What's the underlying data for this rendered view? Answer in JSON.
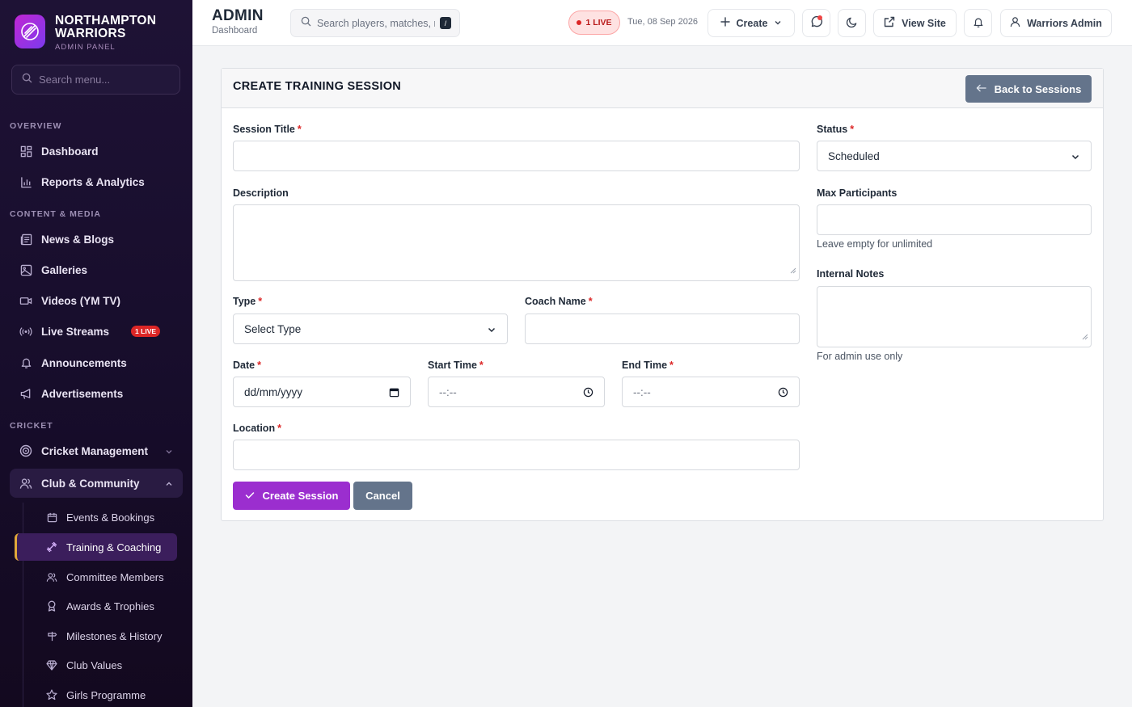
{
  "brand": {
    "name_line1": "NORTHAMPTON",
    "name_line2": "WARRIORS",
    "subtitle": "ADMIN PANEL"
  },
  "sidebar": {
    "search_placeholder": "Search menu...",
    "sections": [
      "OVERVIEW",
      "CONTENT & MEDIA",
      "CRICKET"
    ],
    "items": [
      {
        "label": "Dashboard",
        "icon": "grid-icon"
      },
      {
        "label": "Reports & Analytics",
        "icon": "bar-chart-icon"
      },
      {
        "label": "News & Blogs",
        "icon": "newspaper-icon"
      },
      {
        "label": "Galleries",
        "icon": "image-icon"
      },
      {
        "label": "Videos (YM TV)",
        "icon": "video-icon"
      },
      {
        "label": "Live Streams",
        "icon": "broadcast-icon",
        "badge": "1 LIVE"
      },
      {
        "label": "Announcements",
        "icon": "bell-icon"
      },
      {
        "label": "Advertisements",
        "icon": "megaphone-icon"
      },
      {
        "label": "Cricket Management",
        "icon": "target-icon"
      },
      {
        "label": "Club & Community",
        "icon": "users-icon"
      }
    ],
    "sub_items": [
      {
        "label": "Events & Bookings",
        "icon": "calendar-icon"
      },
      {
        "label": "Training & Coaching",
        "icon": "dumbbell-icon",
        "active": true
      },
      {
        "label": "Committee Members",
        "icon": "users-icon"
      },
      {
        "label": "Awards & Trophies",
        "icon": "award-icon"
      },
      {
        "label": "Milestones & History",
        "icon": "signpost-icon"
      },
      {
        "label": "Club Values",
        "icon": "gem-icon"
      },
      {
        "label": "Girls Programme",
        "icon": "star-icon"
      }
    ]
  },
  "header": {
    "title": "ADMIN",
    "subtitle": "Dashboard",
    "search_placeholder": "Search players, matches, r",
    "search_shortcut": "/",
    "live_label": "1 LIVE",
    "date": "Tue, 08 Sep 2026",
    "create_label": "Create",
    "view_site_label": "View Site",
    "user_label": "Warriors Admin"
  },
  "form": {
    "title": "CREATE TRAINING SESSION",
    "back_label": "Back to Sessions",
    "session_title_label": "Session Title",
    "description_label": "Description",
    "type_label": "Type",
    "type_value": "Select Type",
    "coach_label": "Coach Name",
    "date_label": "Date",
    "date_value": "dd/mm/yyyy",
    "start_label": "Start Time",
    "start_value": "--:--",
    "end_label": "End Time",
    "end_value": "--:--",
    "location_label": "Location",
    "status_label": "Status",
    "status_value": "Scheduled",
    "max_label": "Max Participants",
    "max_hint": "Leave empty for unlimited",
    "notes_label": "Internal Notes",
    "notes_hint": "For admin use only",
    "required_mark": "*",
    "submit_label": "Create Session",
    "cancel_label": "Cancel"
  },
  "colors": {
    "accent": "#9b2ecf",
    "sidebar_bg": "#1e1235",
    "secondary_button": "#64748b",
    "live": "#dc2626"
  }
}
